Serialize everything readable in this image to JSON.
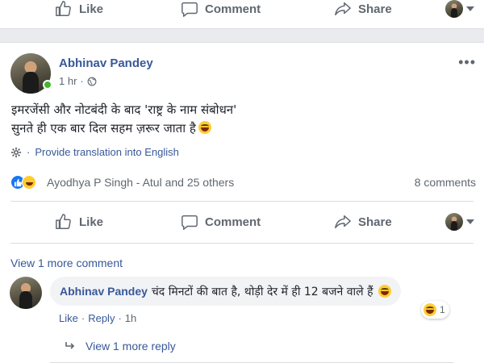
{
  "top_bar": {
    "like_label": "Like",
    "comment_label": "Comment",
    "share_label": "Share"
  },
  "post": {
    "author": "Abhinav Pandey",
    "timestamp": "1 hr",
    "privacy_icon": "globe-icon",
    "text_line1": "इमरजेंसी और नोटबंदी के बाद 'राष्ट्र के नाम संबोधन'",
    "text_line2": "सुनते ही एक बार दिल सहम ज़रूर जाता है",
    "translate_label": "Provide translation into English",
    "reactors": "Ayodhya P Singh - Atul and 25 others",
    "comment_count": "8 comments"
  },
  "actions": {
    "like_label": "Like",
    "comment_label": "Comment",
    "share_label": "Share"
  },
  "comments": {
    "view_more_label": "View 1 more comment",
    "comment": {
      "author": "Abhinav Pandey",
      "text": "चंद मिनटों की बात है, थोड़ी देर में ही 12 बजने वाले हैं",
      "reaction_count": "1",
      "like_label": "Like",
      "reply_label": "Reply",
      "separator": "·",
      "time": "1h"
    },
    "view_more_reply_label": "View 1 more reply"
  },
  "colors": {
    "link": "#385898",
    "muted": "#606770",
    "online": "#42b72a",
    "like_blue": "#1877f2",
    "background": "#e9ebee"
  }
}
